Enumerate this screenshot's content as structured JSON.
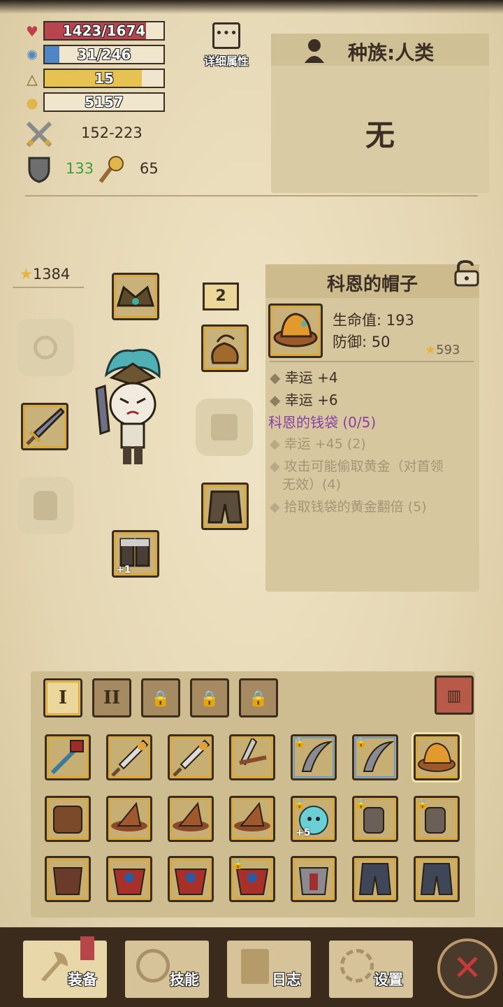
{
  "stats": {
    "hp": {
      "text": "1423/1674",
      "current": 1423,
      "max": 1674,
      "color": "#b7454f"
    },
    "mana": {
      "text": "31/246",
      "current": 31,
      "max": 246,
      "color": "#4f86c6"
    },
    "level": {
      "text": "15",
      "fraction": 0.82,
      "color": "#e5c251"
    },
    "gold": {
      "text": "5157"
    },
    "attack": "152-223",
    "defense": "133",
    "luck": "65"
  },
  "detail_button": {
    "label": "详细属性"
  },
  "race": {
    "title": "种族:人类",
    "value": "无"
  },
  "equipment": {
    "score": "1384",
    "badge": "2",
    "boots_plus": "+1"
  },
  "item_info": {
    "name": "科恩的帽子",
    "hp_label": "生命值: 193",
    "def_label": "防御: 50",
    "score": "593",
    "attrs": [
      "幸运 +4",
      "幸运 +6"
    ],
    "set_name": "科恩的钱袋 (0/5)",
    "set_bonuses": [
      "幸运 +45 (2)",
      "攻击可能偷取黄金（对首领",
      "无效）(4)",
      "拾取钱袋的黄金翻倍 (5)"
    ]
  },
  "inventory": {
    "tabs": [
      "I",
      "II"
    ],
    "plus_label": "+5"
  },
  "nav": {
    "equip": "装备",
    "skills": "技能",
    "log": "日志",
    "settings": "设置",
    "close": "✕"
  },
  "colors": {
    "panel": "#d7c79f",
    "gold_border": "#e1a72d",
    "set_purple": "#8a3fa4",
    "positive_green": "#3aa13a"
  }
}
